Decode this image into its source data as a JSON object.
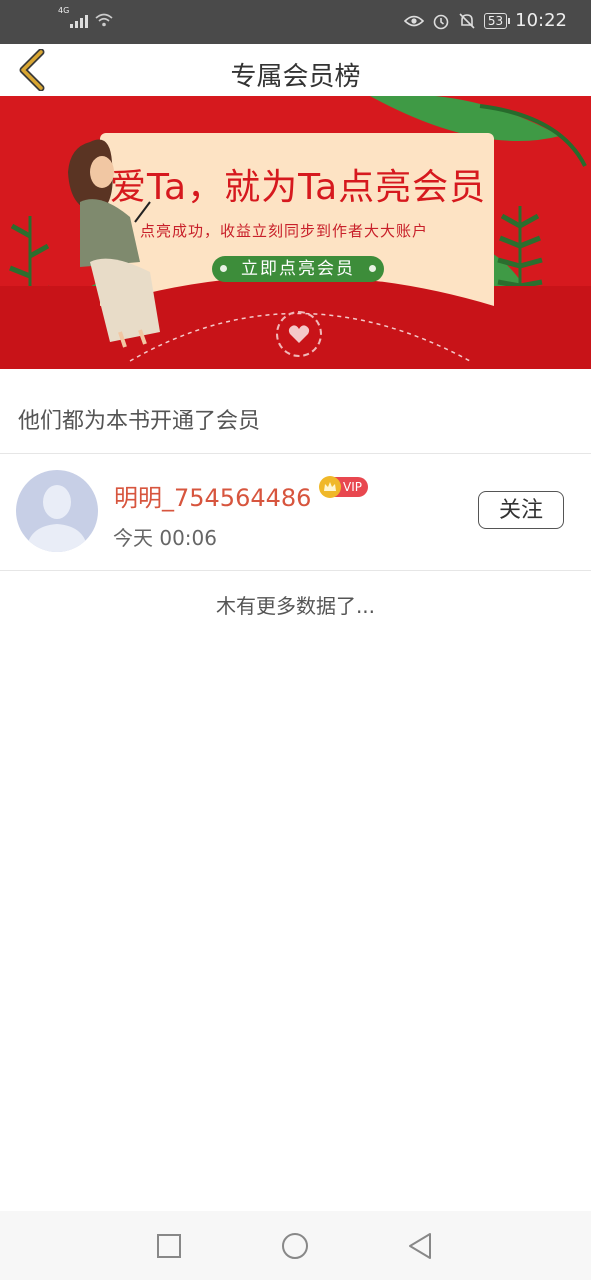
{
  "status_bar": {
    "network_label": "4G",
    "battery": "53",
    "time": "10:22"
  },
  "header": {
    "title": "专属会员榜"
  },
  "banner": {
    "title": "爱Ta，就为Ta点亮会员",
    "subtitle": "点亮成功，收益立刻同步到作者大大账户",
    "button_label": "立即点亮会员"
  },
  "section": {
    "title": "他们都为本书开通了会员"
  },
  "members": [
    {
      "name": "明明_754564486",
      "badge": "VIP",
      "time": "今天 00:06",
      "follow_label": "关注"
    }
  ],
  "list_footer": "木有更多数据了...",
  "colors": {
    "status_bar": "#4a4a4a",
    "banner_red": "#d6191e",
    "name_accent": "#d7553e",
    "vip_red": "#e8474f",
    "crown_gold": "#f0b829",
    "back_arrow": "#d9a632"
  },
  "nav_bar": {
    "icons": [
      "recent-apps-icon",
      "home-icon",
      "back-icon"
    ]
  }
}
